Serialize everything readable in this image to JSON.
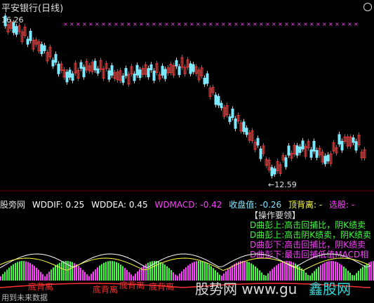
{
  "header": {
    "title": "平安银行(日线)",
    "high_label": "16.26",
    "low_label": "←12.59",
    "colors": {
      "up": "#ff3030",
      "down": "#7fe7ff",
      "magenta": "#ff40ff",
      "bg": "#000000"
    }
  },
  "indicator": {
    "source": "股旁网",
    "wddif": "WDDIF: 0.25",
    "wddea": "WDDEA: 0.45",
    "wdmacd": "WDMACD: -0.42",
    "close": "收盘值: -0.26",
    "top_div": "顶背离: -",
    "select": "选股: -"
  },
  "ops": {
    "header": "【操作要领】",
    "lines": [
      {
        "text": "D曲彭上:高击回捕比，阴K绩卖",
        "color": "#40ff40"
      },
      {
        "text": "D曲彭上:高击阴K绩卖，阴K绩卖",
        "color": "#40ff40"
      },
      {
        "text": "D曲彭下:高击回捕比，阴K绩卖",
        "color": "#ff40ff"
      },
      {
        "text": "D曲彭下:最击回捕低值MACD相",
        "color": "#ff40ff"
      }
    ]
  },
  "divergence": {
    "labels": [
      "底背离",
      "底背离",
      "底背离",
      "底背离"
    ]
  },
  "watermarks": {
    "main": "股势网 www.gu",
    "site": "鑫股网",
    "footer": "用到未来数据"
  }
}
